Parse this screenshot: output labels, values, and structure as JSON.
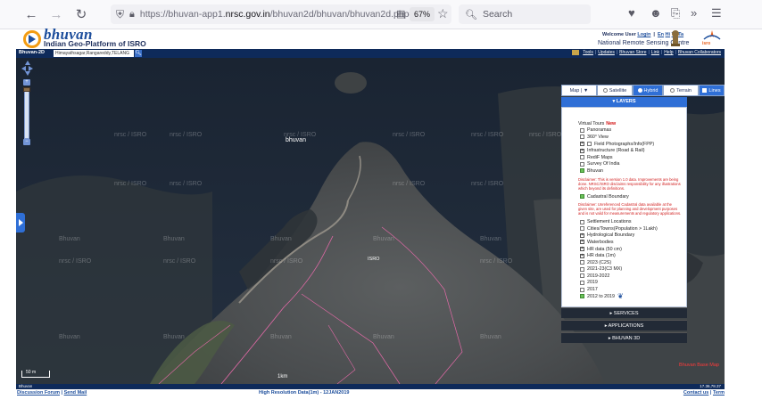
{
  "browser": {
    "url_prefix": "https://bhuvan-app1.",
    "url_domain": "nrsc.gov.in",
    "url_path": "/bhuvan2d/bhuvan/bhuvan2d.php#",
    "zoom": "67%",
    "search_placeholder": "Search"
  },
  "header": {
    "logo_word": "bhuvan",
    "logo_subtitle": "Indian Geo-Platform of ISRO",
    "welcome_prefix": "Welcome User",
    "login_label": "Login",
    "lang_en": "En",
    "lang_hi": "Hi",
    "lang_te": "Te",
    "lang_ta": "Ta",
    "org_name": "National Remote Sensing Centre",
    "isro_label": "isro"
  },
  "nav": {
    "app_title": "Bhuvan-2D",
    "location_value": "Himayathsagar,Rangareddy,TELANG",
    "search_icon": "search-icon",
    "links": [
      "Tools",
      "Updates",
      "Bhuvan Store",
      "Link",
      "Help",
      "Bhuvan Collaborators"
    ]
  },
  "map": {
    "watermark_1": "nrsc / ISRO",
    "watermark_2": "Bhuvan",
    "center_label": "bhuvan",
    "poi_label": "ISRO",
    "scale_label": "50 m",
    "bottom_center_label": "1km",
    "bottom_right_text": "Bhuvan Base Map"
  },
  "base_tabs": [
    {
      "label": "Map | ▼",
      "active": false
    },
    {
      "label": "Satellite",
      "active": false
    },
    {
      "label": "Hybrid",
      "active": true
    },
    {
      "label": "Terrain",
      "active": false
    },
    {
      "label": "Lines",
      "active": true
    }
  ],
  "layers": {
    "header": "LAYERS",
    "virtual_tours": "Virtual Tours",
    "new_badge": "New",
    "items_1": [
      {
        "label": "Panoramas",
        "checked": false
      },
      {
        "label": "360° View",
        "checked": false
      },
      {
        "label": "Field Photographs/Info(FPP)",
        "checked": false
      },
      {
        "label": "Infrastructure (Road & Rail)",
        "checked": true
      },
      {
        "label": "RediF Maps",
        "checked": false
      },
      {
        "label": "Survey Of India",
        "checked": false
      },
      {
        "label": "Bhuvan",
        "checked": true
      }
    ],
    "disclaimer_1": "Disclaimer: This is version 1.0 data. Improvements are being done. NRSC/ISRO disclaims responsibility for any illustrations which beyond its definitions.",
    "cadastral": "Cadastral Boundary",
    "disclaimer_2": "Disclaimer: Unreferenced Cadastral data available at the given site, are used for planning and development purposes and is not valid for measurements and regulatory applications.",
    "items_2": [
      {
        "label": "Settlement Locations",
        "checked": false
      },
      {
        "label": "Cities/Towns(Population > 1Lakh)",
        "checked": false
      },
      {
        "label": "Hydrological Boundary",
        "checked": false
      },
      {
        "label": "Waterbodies",
        "checked": false
      },
      {
        "label": "HR data (50 cm)",
        "checked": true
      },
      {
        "label": "HR data (1m)",
        "checked": true
      },
      {
        "label": "2023 (C2S)",
        "checked": false
      },
      {
        "label": "2021-23(C3 MX)",
        "checked": false
      },
      {
        "label": "2019-2022",
        "checked": false
      },
      {
        "label": "2019",
        "checked": false
      },
      {
        "label": "2017",
        "checked": false
      },
      {
        "label": "2012 to 2019",
        "checked": true
      }
    ]
  },
  "panel_tabs": {
    "services": "▸ SERVICES",
    "applications": "▸ APPLICATIONS",
    "bhuvan3d": "▸ BHUVAN 3D"
  },
  "footer": {
    "bar_left": "Bhuvan",
    "bar_right": "17.36,78.37",
    "discussion": "Discussion Forum",
    "sep": "|",
    "send_mail": "Send Mail",
    "center_text": "High Resolution Data(1m) - 12JAN2019",
    "contact": "Contact us",
    "terms": "Term"
  }
}
